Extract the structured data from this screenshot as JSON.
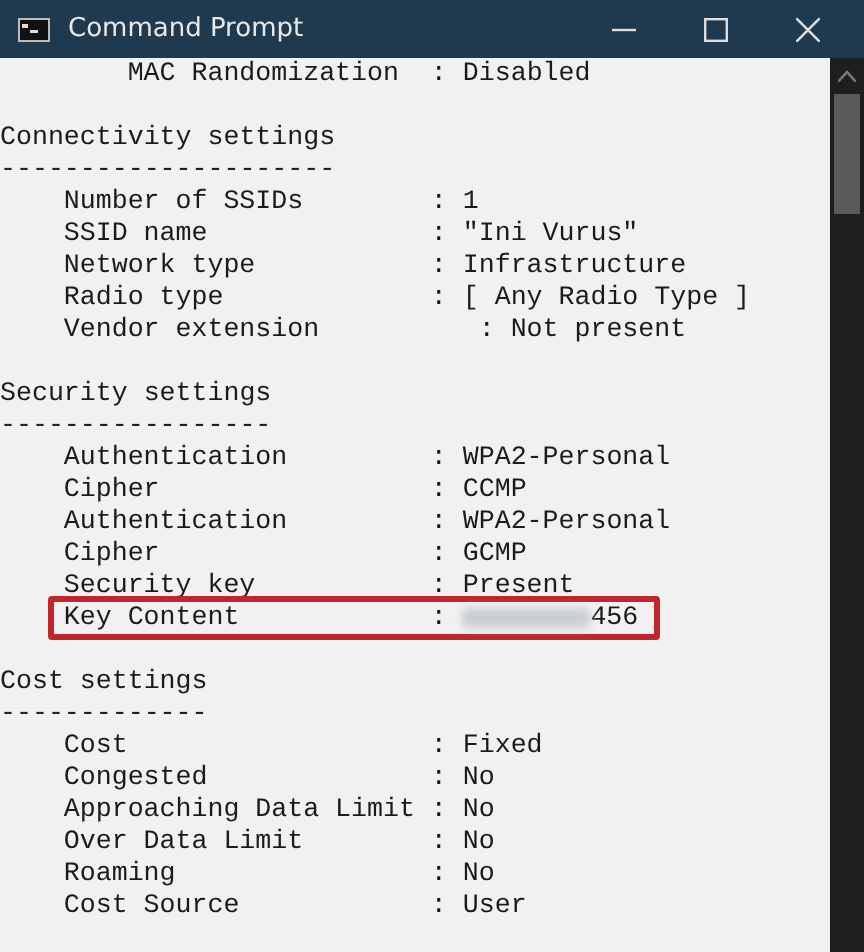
{
  "window": {
    "title": "Command Prompt"
  },
  "console": {
    "lines": [
      {
        "kind": "detail",
        "text": "MAC Randomization  : Disabled"
      },
      {
        "kind": "blank"
      },
      {
        "kind": "heading",
        "text": "Connectivity settings"
      },
      {
        "kind": "rule",
        "text": "---------------------"
      },
      {
        "kind": "field",
        "text": "Number of SSIDs        : 1"
      },
      {
        "kind": "field",
        "text": "SSID name              : \"Ini Vurus\""
      },
      {
        "kind": "field",
        "text": "Network type           : Infrastructure"
      },
      {
        "kind": "field",
        "text": "Radio type             : [ Any Radio Type ]"
      },
      {
        "kind": "field",
        "text": "Vendor extension          : Not present"
      },
      {
        "kind": "blank"
      },
      {
        "kind": "heading",
        "text": "Security settings"
      },
      {
        "kind": "rule",
        "text": "-----------------"
      },
      {
        "kind": "field",
        "text": "Authentication         : WPA2-Personal"
      },
      {
        "kind": "field",
        "text": "Cipher                 : CCMP"
      },
      {
        "kind": "field",
        "text": "Authentication         : WPA2-Personal"
      },
      {
        "kind": "field",
        "text": "Cipher                 : GCMP"
      },
      {
        "kind": "field",
        "text": "Security key           : Present"
      },
      {
        "kind": "secret",
        "label": "Key Content",
        "colon": ":",
        "tail": "456",
        "highlighted": true
      },
      {
        "kind": "blank"
      },
      {
        "kind": "heading",
        "text": "Cost settings"
      },
      {
        "kind": "rule",
        "text": "-------------"
      },
      {
        "kind": "field",
        "text": "Cost                   : Fixed"
      },
      {
        "kind": "field",
        "text": "Congested              : No"
      },
      {
        "kind": "field",
        "text": "Approaching Data Limit : No"
      },
      {
        "kind": "field",
        "text": "Over Data Limit        : No"
      },
      {
        "kind": "field",
        "text": "Roaming                : No"
      },
      {
        "kind": "field",
        "text": "Cost Source            : User"
      }
    ]
  }
}
